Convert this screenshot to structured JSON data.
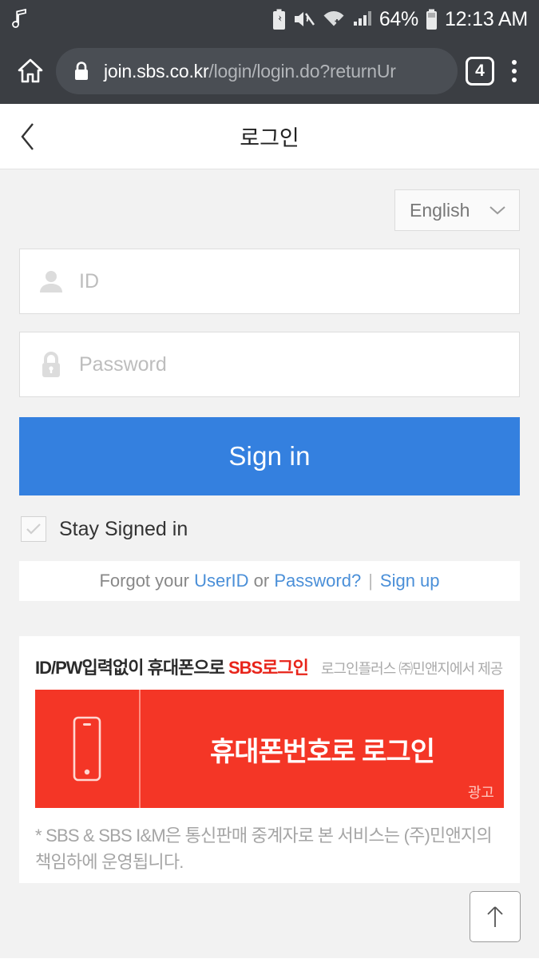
{
  "statusbar": {
    "icons": [
      "music-note-icon",
      "battery-saver-icon",
      "mute-icon",
      "wifi-icon",
      "signal-icon"
    ],
    "battery_percent": "64%",
    "clock": "12:13 AM"
  },
  "browser": {
    "home_icon": "home-icon",
    "lock_icon": "lock-icon",
    "url_host": "join.sbs.co.kr",
    "url_path": "/login/login.do?returnUr",
    "tab_count": "4",
    "menu_icon": "kebab-menu-icon"
  },
  "header": {
    "back_icon": "back-chevron-icon",
    "title": "로그인"
  },
  "form": {
    "language": {
      "selected": "English",
      "chevron_icon": "chevron-down-icon"
    },
    "id_field": {
      "icon": "person-icon",
      "value": "",
      "placeholder": "ID"
    },
    "password_field": {
      "icon": "lock-icon",
      "value": "",
      "placeholder": "Password"
    },
    "signin_label": "Sign in",
    "stay_signed_in": {
      "label": "Stay Signed in",
      "checked": false,
      "check_icon": "check-icon"
    }
  },
  "links": {
    "prefix": "Forgot your",
    "userid": "UserID",
    "or": "or",
    "password": "Password?",
    "separator": "|",
    "signup": "Sign up"
  },
  "ad": {
    "headline": "ID/PW입력없이 휴대폰으로 ",
    "headline_red": "SBS로그인",
    "provider": "로그인플러스 ㈜민앤지에서 제공",
    "banner": {
      "icon": "smartphone-icon",
      "text": "휴대폰번호로 로그인",
      "ad_label": "광고",
      "color": "#f43626"
    },
    "note": "* SBS & SBS I&M은 통신판매 중계자로 본 서비스는 (주)민앤지의 책임하에 운영됩니다."
  },
  "scroll_top": {
    "icon": "arrow-up-icon"
  },
  "colors": {
    "accent_blue": "#3480df",
    "link_blue": "#4a8fd8",
    "ad_red": "#f43626",
    "bg_gray": "#f2f2f2",
    "chrome_dark": "#3b3e43"
  }
}
